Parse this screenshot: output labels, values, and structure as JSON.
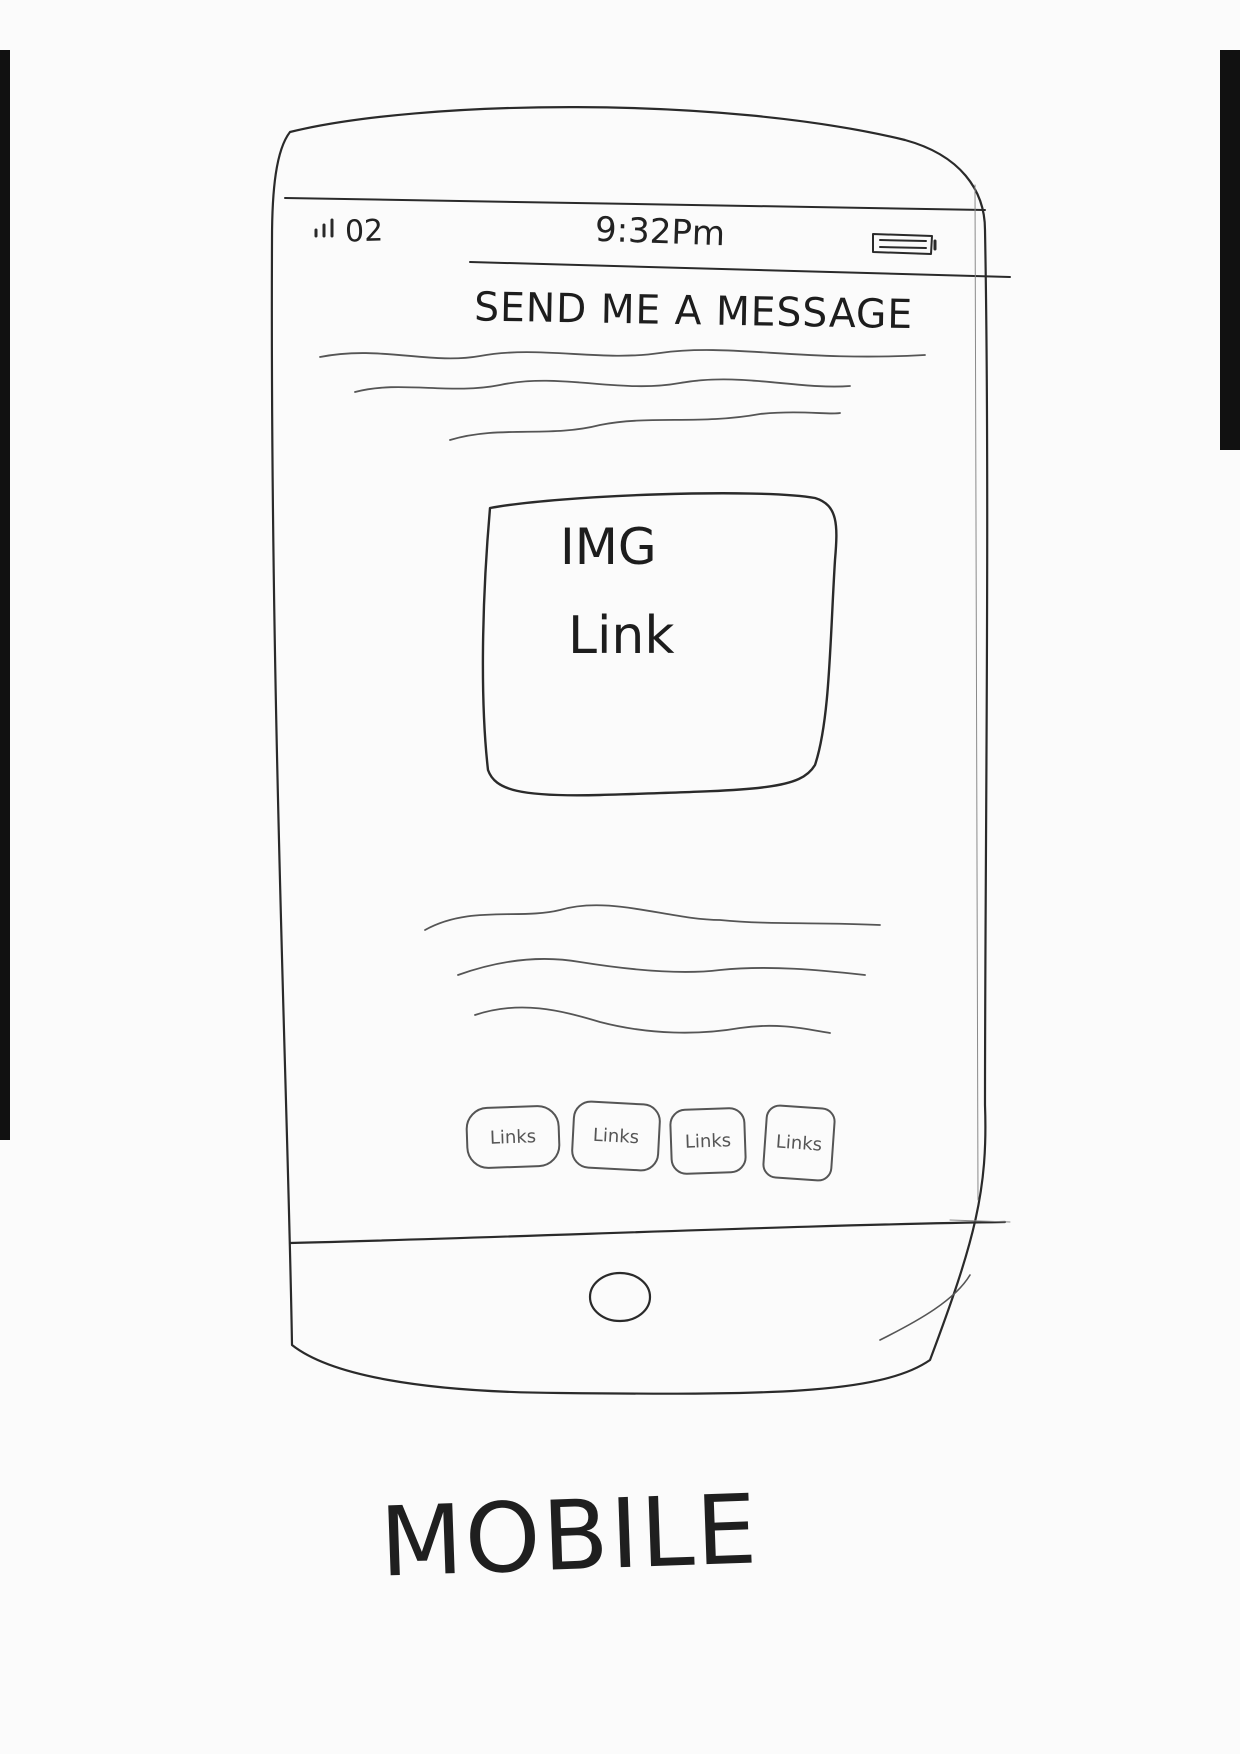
{
  "status_bar": {
    "carrier": "02",
    "time": "9:32Pm"
  },
  "header": {
    "title": "SEND ME A MESSAGE"
  },
  "image_box": {
    "line1": "IMG",
    "line2": "Link"
  },
  "social_links": [
    {
      "label": "Links"
    },
    {
      "label": "Links"
    },
    {
      "label": "Links"
    },
    {
      "label": "Links"
    }
  ],
  "caption": "MOBILE",
  "icons": {
    "signal": "signal-bars-icon",
    "battery": "battery-icon",
    "home": "home-button-icon"
  }
}
